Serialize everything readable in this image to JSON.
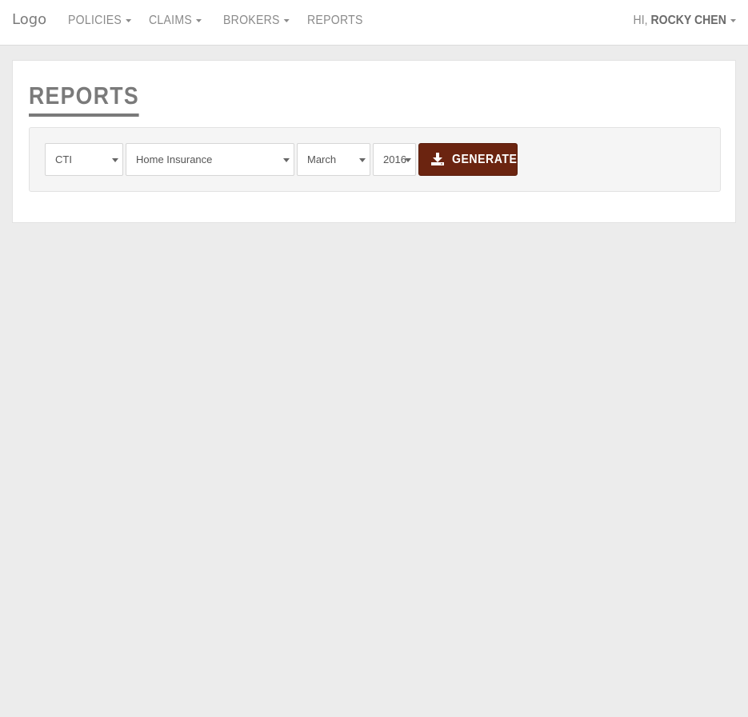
{
  "navbar": {
    "logo": "Logo",
    "items": [
      {
        "label": "Policies",
        "has_caret": true
      },
      {
        "label": "Claims",
        "has_caret": true
      },
      {
        "label": "Brokers",
        "has_caret": true
      },
      {
        "label": "Reports",
        "has_caret": false
      }
    ],
    "greeting": "Hi,",
    "user_name": "Rocky Chen"
  },
  "page": {
    "title": "Reports"
  },
  "filters": {
    "company": "CTI",
    "product": "Home Insurance",
    "month": "March",
    "year": "2016",
    "generate_label": "Generate"
  },
  "colors": {
    "accent": "#6b2410",
    "background": "#ececec"
  },
  "icons": {
    "generate": "download-icon",
    "dropdown": "caret-down-icon"
  }
}
